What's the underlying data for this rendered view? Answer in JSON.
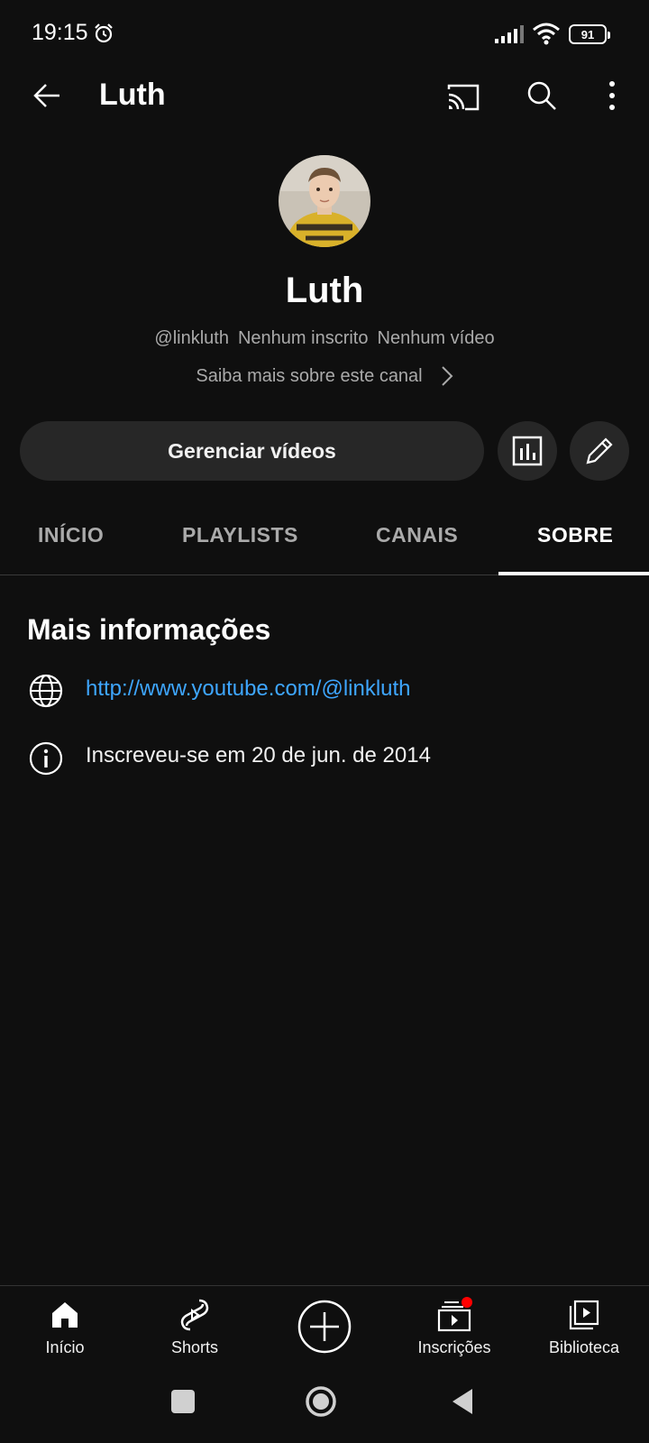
{
  "status_bar": {
    "time": "19:15",
    "battery": "91"
  },
  "header": {
    "title": "Luth"
  },
  "channel": {
    "name": "Luth",
    "handle": "@linkluth",
    "subscribers": "Nenhum inscrito",
    "videos": "Nenhum vídeo",
    "more_about": "Saiba mais sobre este canal"
  },
  "actions": {
    "manage_label": "Gerenciar vídeos"
  },
  "tabs": [
    {
      "label": "INÍCIO",
      "active": false
    },
    {
      "label": "PLAYLISTS",
      "active": false
    },
    {
      "label": "CANAIS",
      "active": false
    },
    {
      "label": "SOBRE",
      "active": true
    }
  ],
  "about": {
    "section_title": "Mais informações",
    "link": "http://www.youtube.com/@linkluth",
    "joined": "Inscreveu-se em 20 de jun. de 2014"
  },
  "bottom_nav": [
    {
      "label": "Início",
      "icon": "home-icon"
    },
    {
      "label": "Shorts",
      "icon": "shorts-icon"
    },
    {
      "label": "",
      "icon": "create-icon"
    },
    {
      "label": "Inscrições",
      "icon": "subscriptions-icon"
    },
    {
      "label": "Biblioteca",
      "icon": "library-icon"
    }
  ],
  "colors": {
    "background": "#0f0f0f",
    "link": "#3ea6ff",
    "notification": "#ff0000"
  }
}
